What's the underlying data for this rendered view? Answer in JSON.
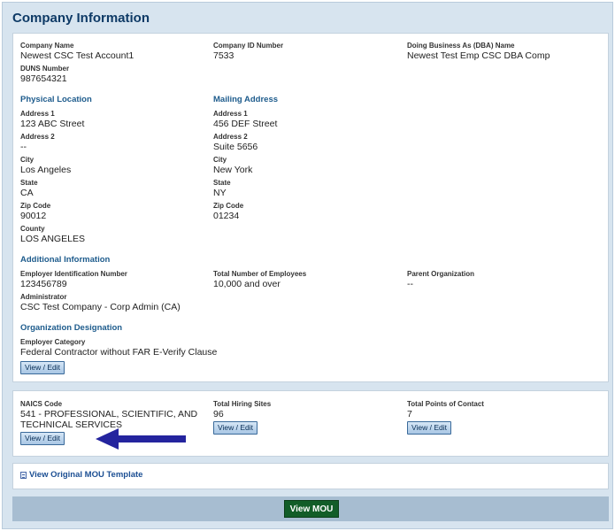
{
  "title": "Company Information",
  "company": {
    "name_label": "Company Name",
    "name": "Newest CSC Test Account1",
    "id_label": "Company ID Number",
    "id": "7533",
    "dba_label": "Doing Business As (DBA) Name",
    "dba": "Newest Test Emp CSC DBA Comp",
    "duns_label": "DUNS Number",
    "duns": "987654321"
  },
  "physical": {
    "heading": "Physical Location",
    "address1_label": "Address 1",
    "address1": "123 ABC Street",
    "address2_label": "Address 2",
    "address2": "--",
    "city_label": "City",
    "city": "Los Angeles",
    "state_label": "State",
    "state": "CA",
    "zip_label": "Zip Code",
    "zip": "90012",
    "county_label": "County",
    "county": "LOS ANGELES"
  },
  "mailing": {
    "heading": "Mailing Address",
    "address1_label": "Address 1",
    "address1": "456 DEF Street",
    "address2_label": "Address 2",
    "address2": "Suite 5656",
    "city_label": "City",
    "city": "New York",
    "state_label": "State",
    "state": "NY",
    "zip_label": "Zip Code",
    "zip": "01234"
  },
  "additional": {
    "heading": "Additional Information",
    "ein_label": "Employer Identification Number",
    "ein": "123456789",
    "employees_label": "Total Number of Employees",
    "employees": "10,000 and over",
    "parent_label": "Parent Organization",
    "parent": "--",
    "admin_label": "Administrator",
    "admin": "CSC Test Company - Corp Admin (CA)"
  },
  "designation": {
    "heading": "Organization Designation",
    "category_label": "Employer Category",
    "category": "Federal Contractor without FAR E-Verify Clause",
    "edit_label": "View / Edit"
  },
  "naics": {
    "label": "NAICS Code",
    "value_line1": "541 - PROFESSIONAL, SCIENTIFIC, AND",
    "value_line2": "TECHNICAL SERVICES",
    "edit_label": "View / Edit"
  },
  "hiring_sites": {
    "label": "Total Hiring Sites",
    "value": "96",
    "edit_label": "View / Edit"
  },
  "contacts": {
    "label": "Total Points of Contact",
    "value": "7",
    "edit_label": "View / Edit"
  },
  "mou_template_link": "View Original MOU Template",
  "view_mou_button": "View MOU",
  "colors": {
    "arrow": "#24249e",
    "view_mou": "#125d28",
    "heading": "#0e3a66"
  }
}
